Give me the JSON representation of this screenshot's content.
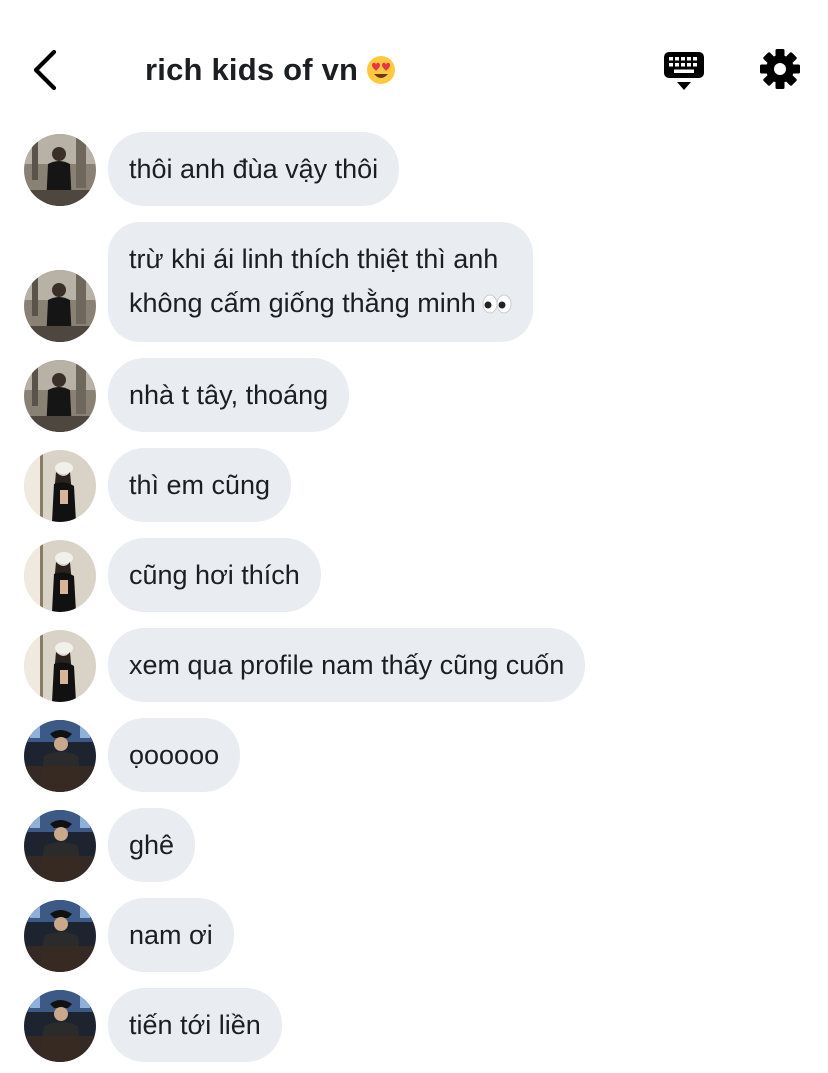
{
  "header": {
    "title": "rich kids of vn",
    "title_emoji": "smiling-face-with-heart-eyes",
    "back_icon": "chevron-left",
    "keyboard_icon": "keyboard-down",
    "settings_icon": "gear"
  },
  "colors": {
    "bubble_bg": "#e9edf1",
    "text": "#1c1e21",
    "icon": "#000000"
  },
  "messages": [
    {
      "sender": "user-a",
      "text": "thôi anh đùa vậy thôi"
    },
    {
      "sender": "user-a",
      "lines": [
        "trừ khi ái linh thích thiệt thì anh",
        "không cấm giống thằng minh"
      ],
      "trailing_emoji": "eyes"
    },
    {
      "sender": "user-a",
      "text": "nhà t tây, thoáng"
    },
    {
      "sender": "user-b",
      "text": "thì em cũng"
    },
    {
      "sender": "user-b",
      "text": "cũng hơi thích"
    },
    {
      "sender": "user-b",
      "text": "xem qua profile nam thấy cũng cuốn"
    },
    {
      "sender": "user-c",
      "text": "ọooooo"
    },
    {
      "sender": "user-c",
      "text": "ghê"
    },
    {
      "sender": "user-c",
      "text": "nam ơi"
    },
    {
      "sender": "user-c",
      "text": "tiến tới liền"
    }
  ]
}
